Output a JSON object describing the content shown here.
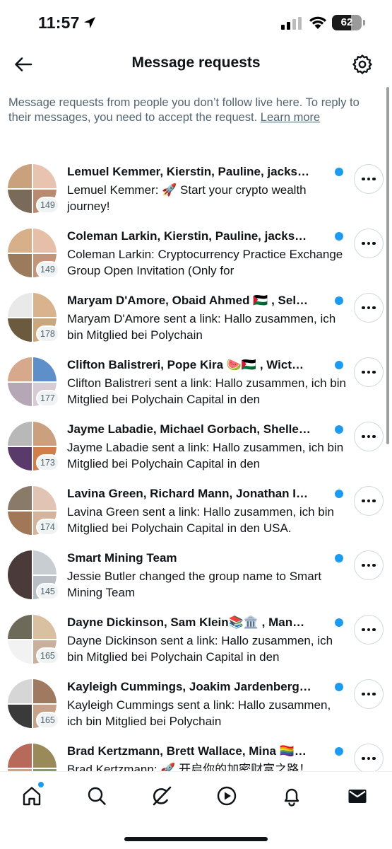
{
  "status_bar": {
    "time": "11:57",
    "battery": "62"
  },
  "header": {
    "title": "Message requests"
  },
  "info": {
    "text": "Message requests from people you don’t follow live here. To reply to their messages, you need to accept the request. ",
    "link": "Learn more"
  },
  "requests": [
    {
      "title": "Lemuel Kemmer, Kierstin, Pauline, jacks…",
      "preview": "Lemuel Kemmer: 🚀 Start your crypto wealth journey!",
      "count": "149",
      "unread": true,
      "colors": [
        "#c9a27d",
        "#e8c4b0",
        "#7a6a5a",
        "#b88a70"
      ]
    },
    {
      "title": "Coleman Larkin, Kierstin, Pauline, jacks…",
      "preview": "Coleman Larkin: Cryptocurrency Practice Exchange Group Open Invitation (Only for",
      "count": "149",
      "unread": true,
      "colors": [
        "#d7b08a",
        "#e5bfa8",
        "#9b7b5b",
        "#c49478"
      ]
    },
    {
      "title": "Maryam D'Amore, Obaid Ahmed 🇵🇸 , Sel…",
      "preview": "Maryam D'Amore sent a link: Hallo zusammen, ich bin Mitglied bei Polychain",
      "count": "178",
      "unread": true,
      "colors": [
        "#e9e9e9",
        "#d9b28e",
        "#6b5a3e",
        "#c9a67c"
      ]
    },
    {
      "title": "Clifton Balistreri, Pope Kira 🍉🇵🇸 , Wict…",
      "preview": "Clifton Balistreri sent a link: Hallo zusammen, ich bin Mitglied bei Polychain Capital in den",
      "count": "177",
      "unread": true,
      "colors": [
        "#d6a88c",
        "#5f8fc8",
        "#b5a7b6",
        "#d8cbd6"
      ]
    },
    {
      "title": "Jayme Labadie, Michael Gorbach, Shelle…",
      "preview": "Jayme Labadie sent a link: Hallo zusammen, ich bin Mitglied bei Polychain Capital in den",
      "count": "173",
      "unread": true,
      "colors": [
        "#b8b8b8",
        "#caa07f",
        "#5a3a6a",
        "#d07f4a"
      ]
    },
    {
      "title": "Lavina Green, Richard Mann, Jonathan I…",
      "preview": "Lavina Green sent a link: Hallo zusammen, ich bin Mitglied bei Polychain Capital in den USA.",
      "count": "174",
      "unread": true,
      "colors": [
        "#8a7a6a",
        "#e2c4b4",
        "#a07858",
        "#d4b49c"
      ]
    },
    {
      "title": "Smart Mining Team",
      "preview": "Jessie Butler changed the group name to Smart Mining Team",
      "count": "145",
      "unread": true,
      "halves": true,
      "colors": [
        "#4a3a3a",
        "#c8cdd2",
        "#2e2a2a",
        "#b8bec4"
      ]
    },
    {
      "title": "Dayne Dickinson, Sam Klein📚🏛️ , Man…",
      "preview": "Dayne Dickinson sent a link: Hallo zusammen, ich bin Mitglied bei Polychain Capital in den",
      "count": "165",
      "unread": true,
      "colors": [
        "#6e6a5a",
        "#d9c0a0",
        "#f2f2f2",
        "#c8b09c"
      ]
    },
    {
      "title": "Kayleigh Cummings, Joakim Jardenberg…",
      "preview": "Kayleigh Cummings sent a link: Hallo zusammen, ich bin Mitglied bei Polychain",
      "count": "165",
      "unread": true,
      "colors": [
        "#d6d6d6",
        "#a07a60",
        "#3a3a3a",
        "#c6a28a"
      ]
    },
    {
      "title": "Brad Kertzmann, Brett Wallace, Mina 🏳️‍🌈…",
      "preview": "Brad Kertzmann: 🚀 开启你的加密财富之路！",
      "count": "",
      "unread": true,
      "colors": [
        "#b86a5a",
        "#9a8a5a",
        "#d0a080",
        "#8a9a6a"
      ]
    }
  ],
  "nav": [
    {
      "name": "home-icon",
      "active": true
    },
    {
      "name": "search-icon"
    },
    {
      "name": "grok-icon"
    },
    {
      "name": "video-play-icon"
    },
    {
      "name": "bell-icon"
    },
    {
      "name": "mail-icon"
    }
  ],
  "accent_color": "#1d9bf0"
}
